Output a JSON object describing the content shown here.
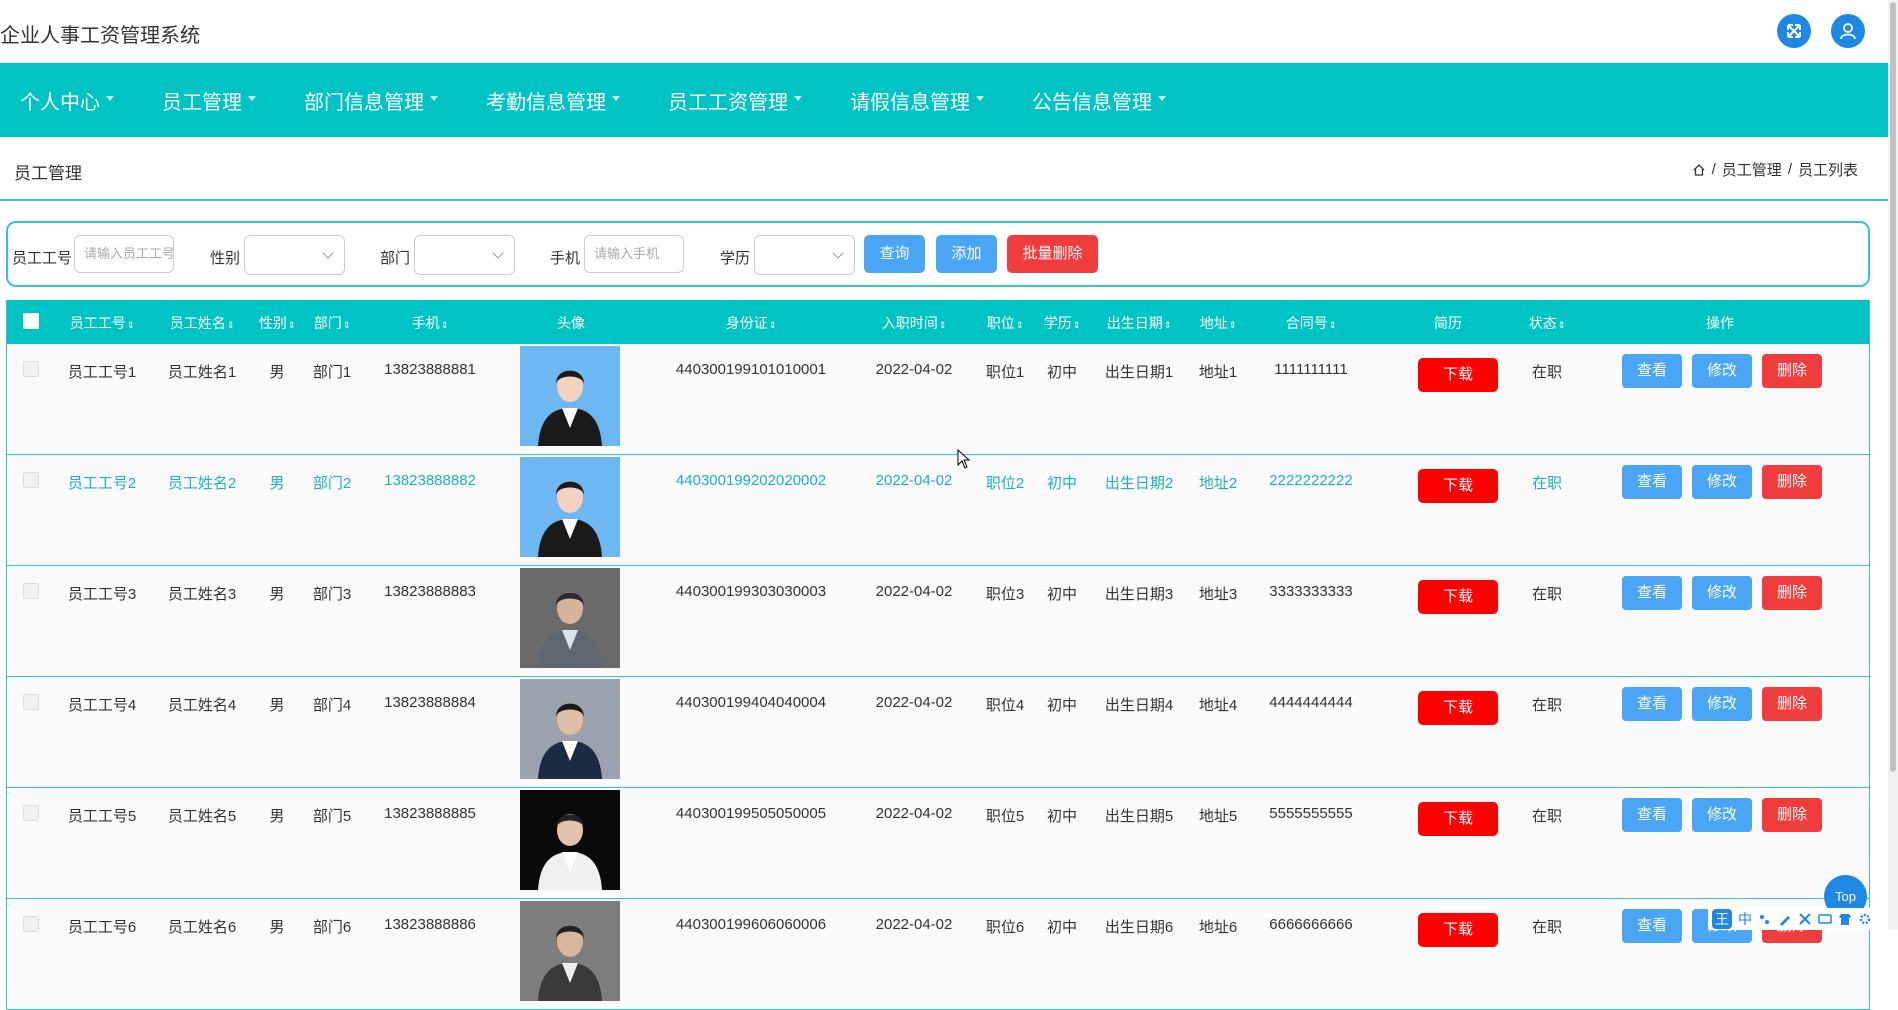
{
  "app": {
    "title": "企业人事工资管理系统"
  },
  "nav": {
    "items": [
      {
        "label": "个人中心"
      },
      {
        "label": "员工管理"
      },
      {
        "label": "部门信息管理"
      },
      {
        "label": "考勤信息管理"
      },
      {
        "label": "员工工资管理"
      },
      {
        "label": "请假信息管理"
      },
      {
        "label": "公告信息管理"
      }
    ]
  },
  "page": {
    "title": "员工管理",
    "breadcrumb": {
      "sep": "/",
      "level1": "员工管理",
      "level2": "员工列表"
    }
  },
  "search": {
    "emp_no_label": "员工工号",
    "emp_no_placeholder": "请输入员工工号",
    "gender_label": "性别",
    "dept_label": "部门",
    "phone_label": "手机",
    "phone_placeholder": "请输入手机",
    "edu_label": "学历",
    "query_btn": "查询",
    "add_btn": "添加",
    "batch_delete_btn": "批量删除"
  },
  "table": {
    "headers": {
      "emp_no": "员工工号",
      "name": "员工姓名",
      "gender": "性别",
      "dept": "部门",
      "phone": "手机",
      "avatar": "头像",
      "id_card": "身份证",
      "join_date": "入职时间",
      "position": "职位",
      "edu": "学历",
      "birth": "出生日期",
      "address": "地址",
      "contract": "合同号",
      "resume": "简历",
      "status": "状态",
      "ops": "操作"
    },
    "sort_glyph": "⇕",
    "download_label": "下载",
    "view_label": "查看",
    "edit_label": "修改",
    "delete_label": "删除",
    "rows": [
      {
        "emp_no": "员工工号1",
        "name": "员工姓名1",
        "gender": "男",
        "dept": "部门1",
        "phone": "13823888881",
        "id_card": "440300199101010001",
        "join_date": "2022-04-02",
        "position": "职位1",
        "edu": "初中",
        "birth": "出生日期1",
        "address": "地址1",
        "contract": "1111111111",
        "status": "在职"
      },
      {
        "emp_no": "员工工号2",
        "name": "员工姓名2",
        "gender": "男",
        "dept": "部门2",
        "phone": "13823888882",
        "id_card": "440300199202020002",
        "join_date": "2022-04-02",
        "position": "职位2",
        "edu": "初中",
        "birth": "出生日期2",
        "address": "地址2",
        "contract": "2222222222",
        "status": "在职"
      },
      {
        "emp_no": "员工工号3",
        "name": "员工姓名3",
        "gender": "男",
        "dept": "部门3",
        "phone": "13823888883",
        "id_card": "440300199303030003",
        "join_date": "2022-04-02",
        "position": "职位3",
        "edu": "初中",
        "birth": "出生日期3",
        "address": "地址3",
        "contract": "3333333333",
        "status": "在职"
      },
      {
        "emp_no": "员工工号4",
        "name": "员工姓名4",
        "gender": "男",
        "dept": "部门4",
        "phone": "13823888884",
        "id_card": "440300199404040004",
        "join_date": "2022-04-02",
        "position": "职位4",
        "edu": "初中",
        "birth": "出生日期4",
        "address": "地址4",
        "contract": "4444444444",
        "status": "在职"
      },
      {
        "emp_no": "员工工号5",
        "name": "员工姓名5",
        "gender": "男",
        "dept": "部门5",
        "phone": "13823888885",
        "id_card": "440300199505050005",
        "join_date": "2022-04-02",
        "position": "职位5",
        "edu": "初中",
        "birth": "出生日期5",
        "address": "地址5",
        "contract": "5555555555",
        "status": "在职"
      },
      {
        "emp_no": "员工工号6",
        "name": "员工姓名6",
        "gender": "男",
        "dept": "部门6",
        "phone": "13823888886",
        "id_card": "440300199606060006",
        "join_date": "2022-04-02",
        "position": "职位6",
        "edu": "初中",
        "birth": "出生日期6",
        "address": "地址6",
        "contract": "6666666666",
        "status": "在职"
      }
    ]
  },
  "floating": {
    "top_btn": "Top"
  },
  "ime": {
    "logo": "王",
    "lang": "中"
  },
  "icons": {
    "fullscreen": "fullscreen-icon",
    "user": "user-icon",
    "home": "home-icon"
  },
  "colors": {
    "accent": "#00c4c4",
    "primary_blue": "#4aa6f5",
    "danger_red": "#ef3d3d",
    "download_red": "#ff0000"
  }
}
